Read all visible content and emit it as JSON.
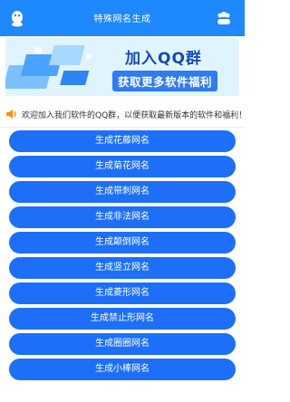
{
  "header": {
    "title": "特殊网名生成"
  },
  "banner": {
    "line1": "加入QQ群",
    "line2": "获取更多软件福利"
  },
  "notice": {
    "text": "欢迎加入我们软件的QQ群，以便获取最新版本的软件和福利！"
  },
  "buttons": [
    "生成花藤网名",
    "生成菊花网名",
    "生成带刺网名",
    "生成非法网名",
    "生成颠倒网名",
    "生成竖立网名",
    "生成菱形网名",
    "生成禁止形网名",
    "生成圈圈网名",
    "生成小棒网名"
  ],
  "colors": {
    "primary": "#1e88ff",
    "button": "#1d6ff7"
  }
}
